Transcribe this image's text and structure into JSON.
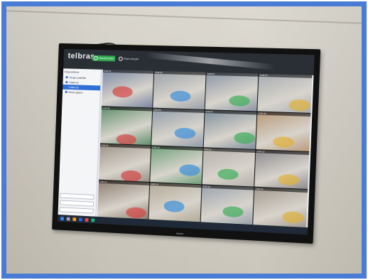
{
  "photo": {
    "subject": "wall-mounted monitor showing camera surveillance grid"
  },
  "monitor": {
    "brand": "telbras",
    "tabs": [
      {
        "icon": "camera-icon",
        "label": "Visualização",
        "active": true
      },
      {
        "icon": "playback-icon",
        "label": "Reprodução",
        "active": false
      }
    ],
    "sidebar": {
      "title": "Dispositivos",
      "items": [
        {
          "label": "Grupo padrão",
          "selected": false
        },
        {
          "label": "CAM 01",
          "selected": false
        },
        {
          "label": "CAM 02",
          "selected": true
        },
        {
          "label": "Novo grupo",
          "selected": false
        }
      ]
    }
  },
  "cameras": [
    {
      "label": "CAM 01",
      "tint": "#7a86a3"
    },
    {
      "label": "CAM 02",
      "tint": "#9aa0a8"
    },
    {
      "label": "CAM 03",
      "tint": "#8a95a6"
    },
    {
      "label": "CAM 04",
      "tint": "#a7adb3"
    },
    {
      "label": "CAM 05",
      "tint": "#5f8f6a"
    },
    {
      "label": "CAM 06",
      "tint": "#8f9ca8"
    },
    {
      "label": "CAM 07",
      "tint": "#7f8e9c"
    },
    {
      "label": "CAM 08",
      "tint": "#b89a7a"
    },
    {
      "label": "CAM 09",
      "tint": "#9c9387"
    },
    {
      "label": "CAM 10",
      "tint": "#6fa07a"
    },
    {
      "label": "CAM 11",
      "tint": "#b4b1aa"
    },
    {
      "label": "CAM 12",
      "tint": "#8c8a8e"
    },
    {
      "label": "CAM 13",
      "tint": "#8d7c6e"
    },
    {
      "label": "CAM 14",
      "tint": "#b2a996"
    },
    {
      "label": "CAM 15",
      "tint": "#9aa3ae"
    },
    {
      "label": "CAM 16",
      "tint": "#a39a90"
    }
  ],
  "colors": {
    "frame": "#4a7cd6",
    "accent": "#2fa84f"
  }
}
